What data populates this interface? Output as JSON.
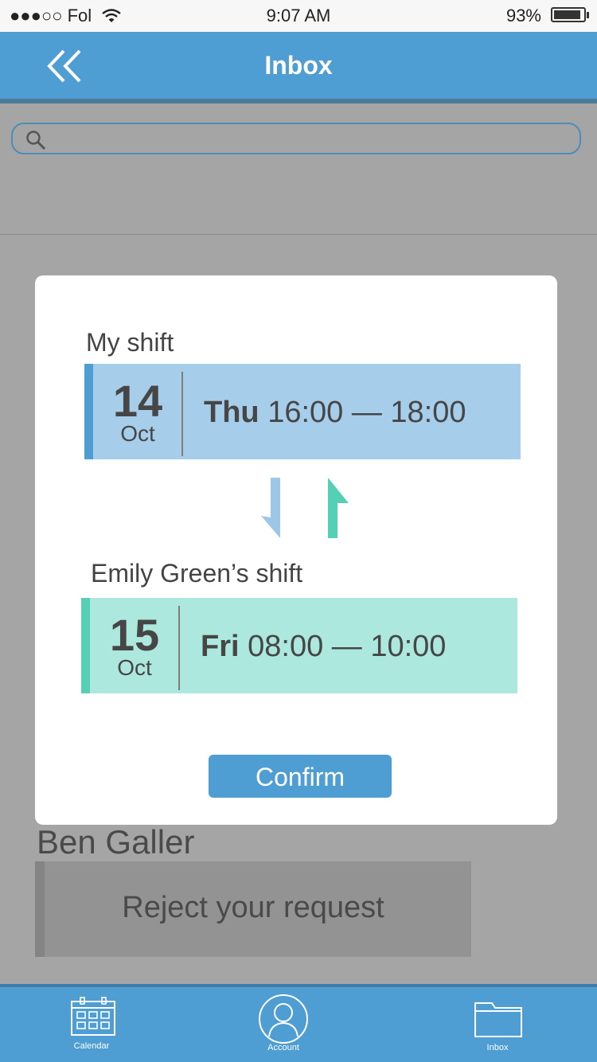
{
  "status_bar": {
    "signal": "●●●○○",
    "carrier": "Fol",
    "time": "9:07 AM",
    "battery": "93%",
    "battery_level": 0.93
  },
  "header": {
    "title": "Inbox",
    "back_icon": "double-chevron-left-icon"
  },
  "search": {
    "placeholder": "",
    "value": "",
    "icon": "search-icon"
  },
  "background_item": {
    "name": "Ben Galler",
    "message": "Reject your request"
  },
  "modal": {
    "my_shift": {
      "label": "My shift",
      "day": "14",
      "month": "Oct",
      "weekday": "Thu",
      "time": "16:00 — 18:00",
      "color": "#a6cdea",
      "strip_color": "#4e9ed4"
    },
    "swap_icons": [
      "arrow-down-icon",
      "arrow-up-icon"
    ],
    "other_shift": {
      "label": "Emily Green’s shift",
      "day": "15",
      "month": "Oct",
      "weekday": "Fri",
      "time": "08:00 — 10:00",
      "color": "#ade8de",
      "strip_color": "#55d0b4"
    },
    "confirm_label": "Confirm"
  },
  "tabbar": {
    "tabs": [
      {
        "label": "Calendar",
        "icon": "calendar-icon"
      },
      {
        "label": "Account",
        "icon": "user-icon"
      },
      {
        "label": "Inbox",
        "icon": "folder-icon"
      }
    ]
  },
  "colors": {
    "accent": "#4e9ed4",
    "overlay_bg": "#a5a5a5"
  }
}
